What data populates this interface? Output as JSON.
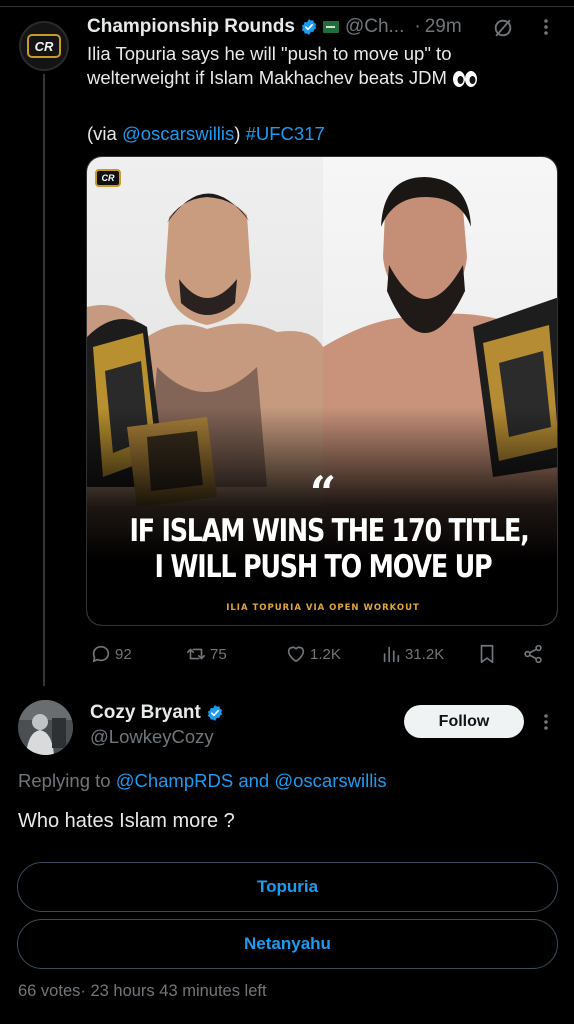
{
  "colors": {
    "background": "#000000",
    "text": "#e7e9ea",
    "muted": "#71767b",
    "link": "#1d9bf0",
    "verified": "#1d9bf0",
    "follow_bg": "#eff3f4"
  },
  "parent_tweet": {
    "avatar_icon": "championship-rounds-logo",
    "avatar_text": "CR",
    "author_name": "Championship Rounds",
    "handle": "@Ch...",
    "separator": "·",
    "time": "29m",
    "text_line1": "Ilia Topuria says he will \"push to move up\" to",
    "text_line2": "welterweight if Islam Makhachev beats JDM",
    "via_prefix": "(via ",
    "via_link": "@oscarswillis",
    "via_suffix": ")",
    "hashtag": "#UFC317",
    "media": {
      "logo_text": "CR",
      "quote_mark": "“",
      "headline_line1": "IF ISLAM WINS THE 170 TITLE,",
      "headline_line2": "I WILL PUSH TO MOVE UP",
      "credit": "ILIA TOPURIA VIA OPEN WORKOUT"
    },
    "actions": {
      "replies": "92",
      "reposts": "75",
      "likes": "1.2K",
      "views": "31.2K"
    }
  },
  "reply": {
    "author_name": "Cozy Bryant",
    "handle": "@LowkeyCozy",
    "follow_label": "Follow",
    "replying_prefix": "Replying to ",
    "replying_to_1": "@ChampRDS",
    "replying_and": " and ",
    "replying_to_2": "@oscarswillis",
    "text": "Who hates Islam more ?",
    "poll": {
      "options": [
        "Topuria",
        "Netanyahu"
      ],
      "votes": "66 votes",
      "separator": "·",
      "time_left": "23 hours 43 minutes left"
    }
  }
}
